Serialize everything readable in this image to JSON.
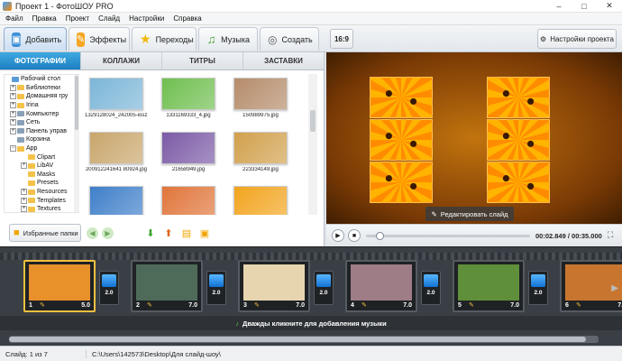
{
  "window": {
    "title": "Проект 1 - ФотоШОУ PRO",
    "minimize": "–",
    "maximize": "□",
    "close": "✕"
  },
  "menu": [
    "Файл",
    "Правка",
    "Проект",
    "Слайд",
    "Настройки",
    "Справка"
  ],
  "tabs": [
    {
      "label": "Добавить",
      "icon": "add-photo-icon"
    },
    {
      "label": "Эффекты",
      "icon": "effects-icon"
    },
    {
      "label": "Переходы",
      "icon": "star-icon"
    },
    {
      "label": "Музыка",
      "icon": "music-icon"
    },
    {
      "label": "Создать",
      "icon": "create-icon"
    }
  ],
  "toolbar": {
    "ratio": "16:9",
    "project_settings": "Настройки проекта"
  },
  "subtabs": [
    "ФОТОГРАФИИ",
    "КОЛЛАЖИ",
    "ТИТРЫ",
    "ЗАСТАВКИ"
  ],
  "tree": [
    {
      "label": "Рабочий стол",
      "type": "desktop",
      "expand": ""
    },
    {
      "label": "Библиотеки",
      "type": "folder",
      "expand": "+"
    },
    {
      "label": "Домашняя гру",
      "type": "folder",
      "expand": "+"
    },
    {
      "label": "Irina",
      "type": "folder",
      "expand": "+"
    },
    {
      "label": "Компьютер",
      "type": "drive",
      "expand": "+"
    },
    {
      "label": "Сеть",
      "type": "drive",
      "expand": "+"
    },
    {
      "label": "Панель управ",
      "type": "drive",
      "expand": "+"
    },
    {
      "label": "Корзина",
      "type": "drive",
      "expand": ""
    },
    {
      "label": "App",
      "type": "folder",
      "expand": "−"
    },
    {
      "label": "Clipart",
      "type": "folder",
      "expand": ""
    },
    {
      "label": "LibAV",
      "type": "folder",
      "expand": "+"
    },
    {
      "label": "Masks",
      "type": "folder",
      "expand": ""
    },
    {
      "label": "Presets",
      "type": "folder",
      "expand": ""
    },
    {
      "label": "Resources",
      "type": "folder",
      "expand": "+"
    },
    {
      "label": "Templates",
      "type": "folder",
      "expand": "+"
    },
    {
      "label": "Textures",
      "type": "folder",
      "expand": "+"
    }
  ],
  "thumbnails": [
    {
      "name": "1329128024_242005-iosz...",
      "color": "#7cb6d8"
    },
    {
      "name": "1331169333_4.jpg",
      "color": "#6fbf4f"
    },
    {
      "name": "150989975.jpg",
      "color": "#b58c6a"
    },
    {
      "name": "200912241641 80924.jpg",
      "color": "#c9a66b"
    },
    {
      "name": "21658949.jpg",
      "color": "#7b5aa6"
    },
    {
      "name": "223334149.jpg",
      "color": "#d1a04c"
    },
    {
      "name": "",
      "color": "#3f7fc9"
    },
    {
      "name": "",
      "color": "#e0753a"
    },
    {
      "name": "",
      "color": "#f2a41e"
    }
  ],
  "left_footer": {
    "favorites": "Избранные папки"
  },
  "preview": {
    "edit_slide": "Редактировать слайд"
  },
  "player": {
    "timecode": "00:02.849 / 00:35.000",
    "progress": 0.08
  },
  "timeline": {
    "slides": [
      {
        "num": "1",
        "dur": "5.0",
        "color": "#e8902a",
        "selected": true
      },
      {
        "num": "2",
        "dur": "7.0",
        "color": "#4d6b58",
        "selected": false
      },
      {
        "num": "3",
        "dur": "7.0",
        "color": "#e7d5b0",
        "selected": false
      },
      {
        "num": "4",
        "dur": "7.0",
        "color": "#9e7d86",
        "selected": false
      },
      {
        "num": "5",
        "dur": "7.0",
        "color": "#5f8f3a",
        "selected": false
      },
      {
        "num": "6",
        "dur": "7.0",
        "color": "#c8762f",
        "selected": false
      }
    ],
    "transitions": [
      "2.0",
      "2.0",
      "2.0",
      "2.0",
      "2.0",
      "2.0"
    ],
    "music_hint": "Дважды кликните для добавления музыки"
  },
  "status": {
    "slide": "Слайд: 1 из 7",
    "path": "C:\\Users\\142573\\Desktop\\Для слайд-шоу\\"
  }
}
